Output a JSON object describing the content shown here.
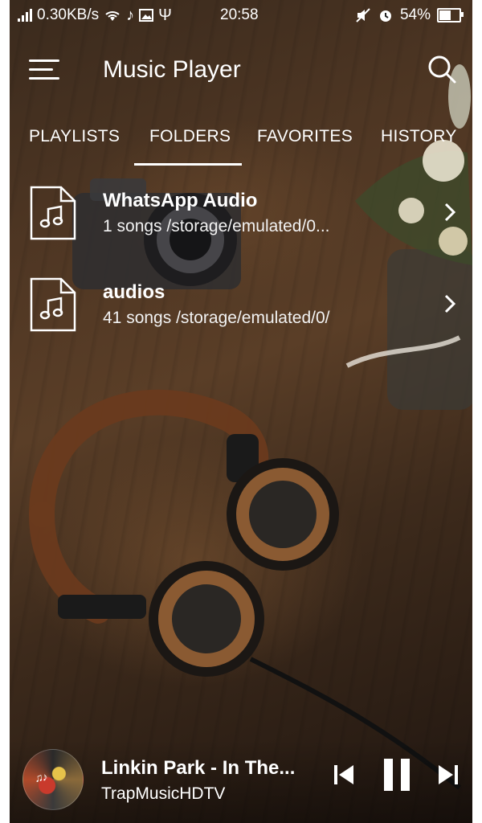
{
  "status_bar": {
    "network_speed": "0.30KB/s",
    "time": "20:58",
    "battery": "54%",
    "battery_level": 0.54,
    "icons": [
      "signal-icon",
      "wifi-icon",
      "music-note-icon",
      "image-icon",
      "usb-icon",
      "mute-icon",
      "alarm-icon",
      "battery-icon"
    ]
  },
  "app_bar": {
    "title": "Music Player",
    "menu_icon": "hamburger-menu-icon",
    "search_icon": "search-icon"
  },
  "tabs": [
    {
      "label": "PLAYLISTS",
      "active": false
    },
    {
      "label": "FOLDERS",
      "active": true
    },
    {
      "label": "FAVORITES",
      "active": false
    },
    {
      "label": "HISTORY",
      "active": false
    }
  ],
  "folders": [
    {
      "name": "WhatsApp Audio",
      "info": "1 songs /storage/emulated/0...",
      "icon": "audio-file-icon"
    },
    {
      "name": "audios",
      "info": "41 songs /storage/emulated/0/",
      "icon": "audio-file-icon"
    }
  ],
  "now_playing": {
    "title": "Linkin Park - In The...",
    "artist": "TrapMusicHDTV",
    "controls": [
      "previous-icon",
      "pause-icon",
      "next-icon"
    ]
  }
}
